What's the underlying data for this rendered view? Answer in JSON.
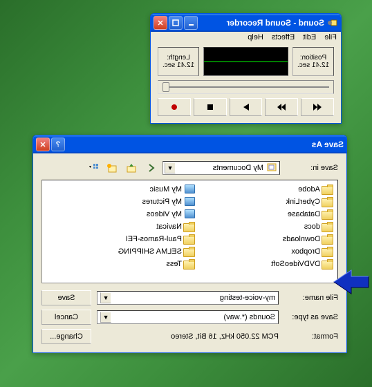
{
  "recorder": {
    "title": "Sound - Sound Recorder",
    "menu": [
      "File",
      "Edit",
      "Effects",
      "Help"
    ],
    "position_label": "Position:",
    "position_value": "12.41 sec.",
    "length_label": "Length:",
    "length_value": "12.41 sec."
  },
  "saveas": {
    "title": "Save As",
    "savein_label": "Save in:",
    "savein_value": "My Documents",
    "files_col1": [
      {
        "name": "Adobe",
        "type": "folder"
      },
      {
        "name": "CyberLink",
        "type": "folder"
      },
      {
        "name": "Database",
        "type": "folder"
      },
      {
        "name": "docs",
        "type": "folder"
      },
      {
        "name": "Downloads",
        "type": "folder"
      },
      {
        "name": "Dropbox",
        "type": "folder"
      },
      {
        "name": "DVDVideoSoft",
        "type": "folder"
      },
      {
        "name": "My Music",
        "type": "special"
      }
    ],
    "files_col2": [
      {
        "name": "My Pictures",
        "type": "special"
      },
      {
        "name": "My Videos",
        "type": "special"
      },
      {
        "name": "Navicat",
        "type": "folder"
      },
      {
        "name": "Paul-Ramos-FEI",
        "type": "folder"
      },
      {
        "name": "SELMA SHIPPING",
        "type": "folder"
      },
      {
        "name": "Tess",
        "type": "folder"
      }
    ],
    "filename_label": "File name:",
    "filename_value": "my-voice-testing",
    "savetype_label": "Save as type:",
    "savetype_value": "Sounds (*.wav)",
    "format_label": "Format:",
    "format_value": "PCM 22.050 kHz, 16 Bit, Stereo",
    "save_btn": "Save",
    "cancel_btn": "Cancel",
    "change_btn": "Change..."
  }
}
